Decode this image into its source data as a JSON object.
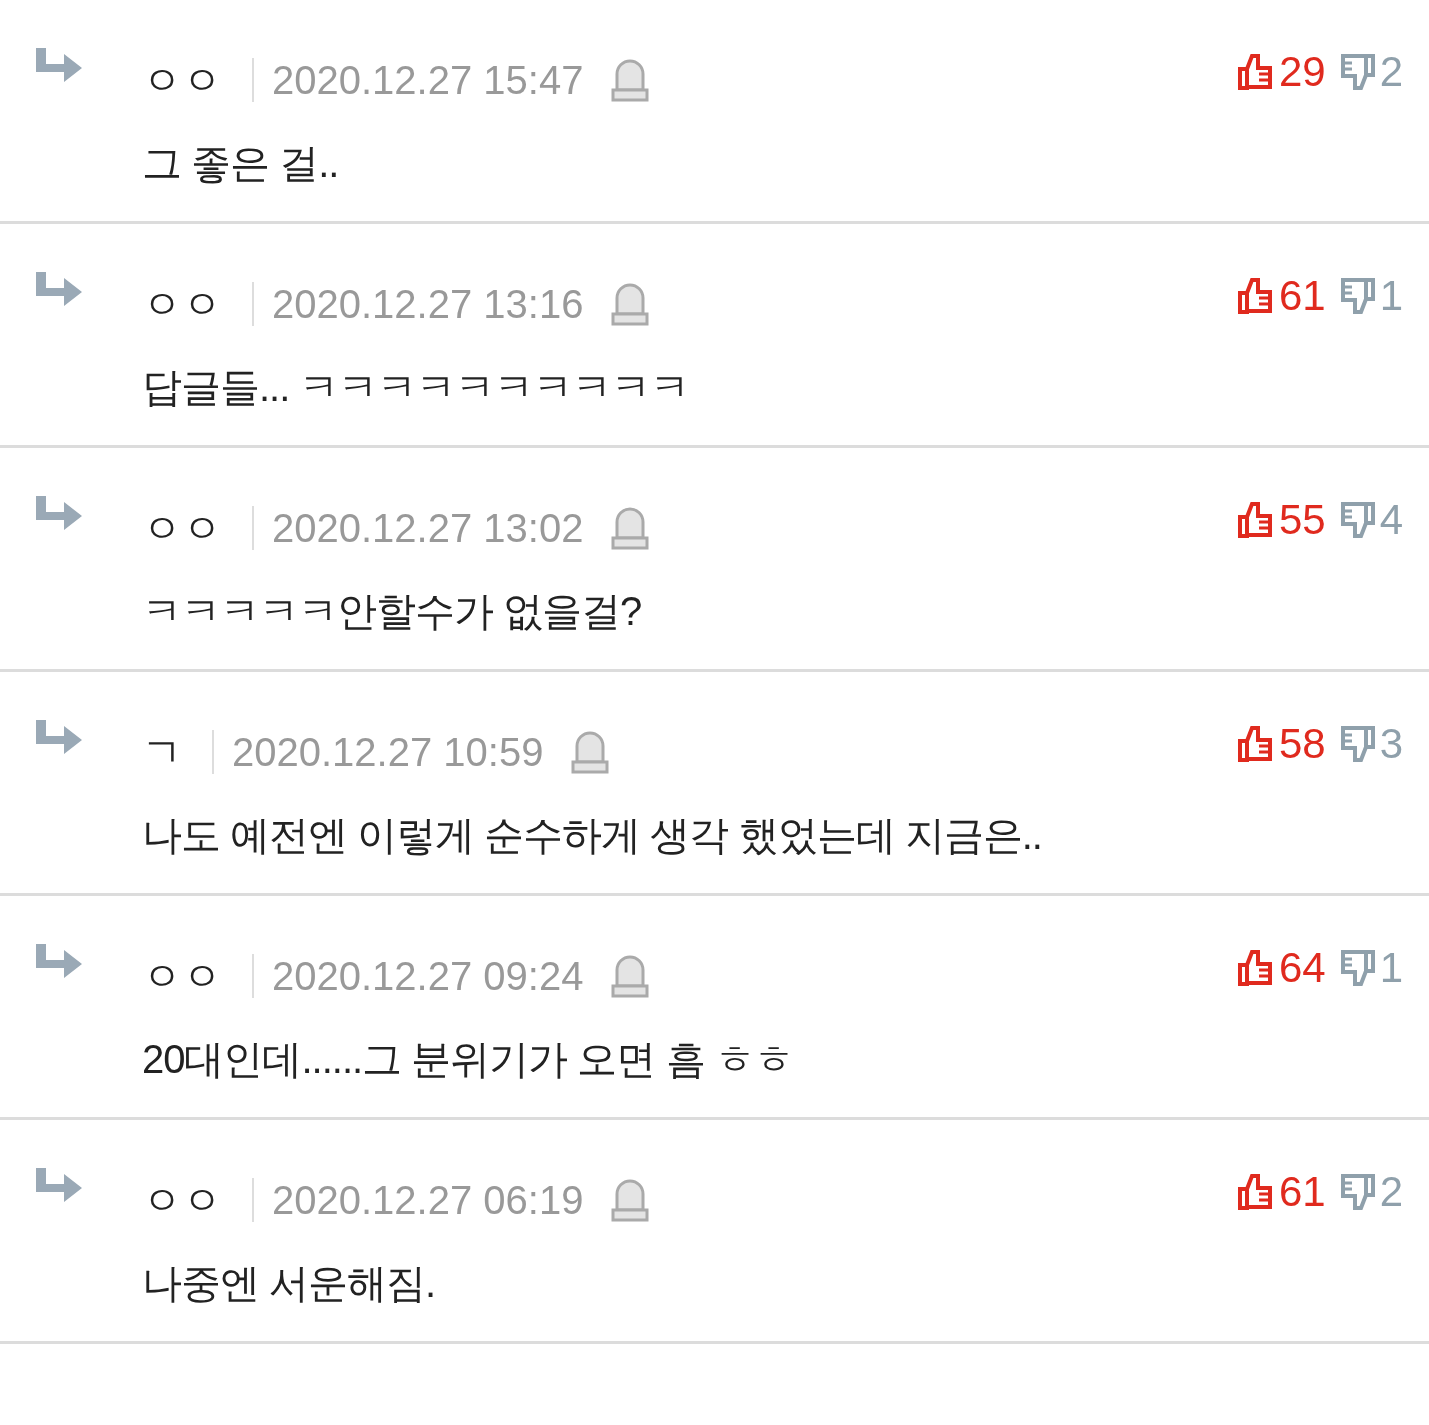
{
  "comments": [
    {
      "author": "ㅇㅇ",
      "date": "2020.12.27 15:47",
      "text": "그 좋은 걸..",
      "likes": "29",
      "dislikes": "2"
    },
    {
      "author": "ㅇㅇ",
      "date": "2020.12.27 13:16",
      "text": "답글들... ㅋㅋㅋㅋㅋㅋㅋㅋㅋㅋ",
      "likes": "61",
      "dislikes": "1"
    },
    {
      "author": "ㅇㅇ",
      "date": "2020.12.27 13:02",
      "text": "ㅋㅋㅋㅋㅋ안할수가 없을걸?",
      "likes": "55",
      "dislikes": "4"
    },
    {
      "author": "ㄱ",
      "date": "2020.12.27 10:59",
      "text": "나도 예전엔 이렇게 순수하게 생각 했었는데 지금은..",
      "likes": "58",
      "dislikes": "3"
    },
    {
      "author": "ㅇㅇ",
      "date": "2020.12.27 09:24",
      "text": "20대인데......그 분위기가 오면 흠 ㅎㅎ",
      "likes": "64",
      "dislikes": "1"
    },
    {
      "author": "ㅇㅇ",
      "date": "2020.12.27 06:19",
      "text": "나중엔 서운해짐.",
      "likes": "61",
      "dislikes": "2"
    }
  ]
}
